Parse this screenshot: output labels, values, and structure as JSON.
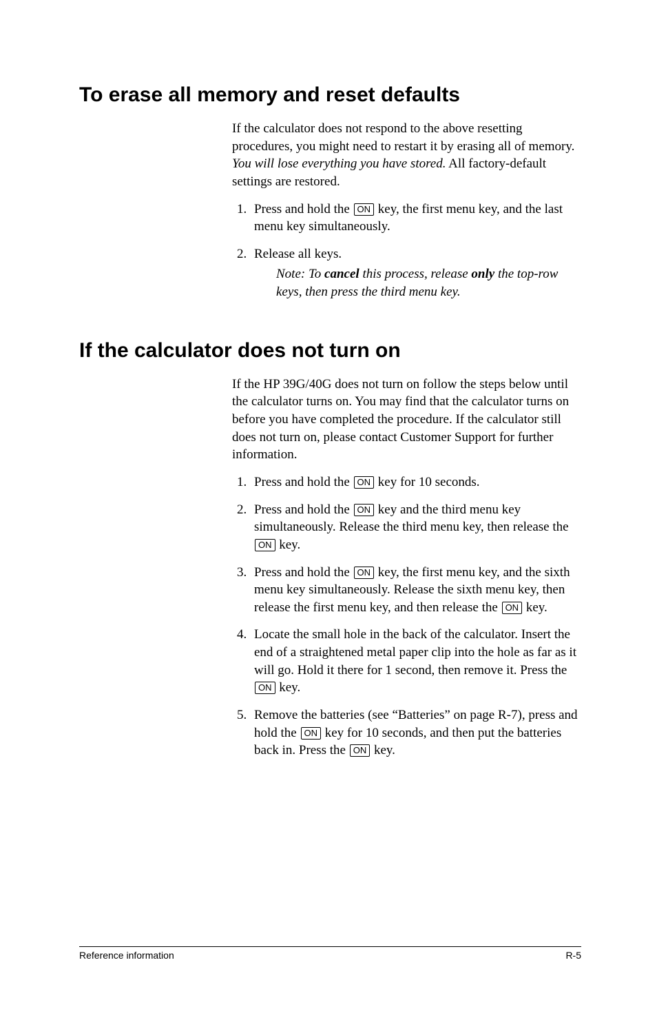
{
  "key_on": "ON",
  "section1": {
    "heading": "To erase all memory and reset defaults",
    "intro_a": "If the calculator does not respond to the above resetting procedures, you might need to restart it by erasing all of memory. ",
    "intro_italic": "You will lose everything you have stored.",
    "intro_b": " All factory-default settings are restored.",
    "step1_a": "Press and hold the ",
    "step1_b": " key, the first menu key, and the last menu key simultaneously.",
    "step2": "Release all keys.",
    "note_prefix": "Note: To ",
    "note_cancel": "cancel",
    "note_mid": " this process, release ",
    "note_only": "only",
    "note_tail": " the top-row keys, then press the third menu key."
  },
  "section2": {
    "heading": "If the calculator does not turn on",
    "intro": "If the HP 39G/40G does not turn on follow the steps below until the calculator turns on. You may find that the calculator turns on before you have completed the procedure. If the calculator still does not turn on, please contact Customer Support for further information.",
    "s1_a": "Press and hold the ",
    "s1_b": " key for 10 seconds.",
    "s2_a": "Press and hold the ",
    "s2_b": " key and the third menu key simultaneously. Release the third menu key, then release the ",
    "s2_c": " key.",
    "s3_a": "Press and hold the ",
    "s3_b": " key, the first menu key, and the sixth menu key simultaneously. Release the sixth menu key, then release the first menu key, and then release the ",
    "s3_c": " key.",
    "s4_a": "Locate the small hole in the back of the calculator. Insert the end of a straightened metal paper clip into the hole as far as it will go. Hold it there for 1 second, then remove it. Press the ",
    "s4_b": " key.",
    "s5_a": "Remove the batteries (see “Batteries” on page R-7), press and hold the ",
    "s5_b": " key for 10 seconds, and then put the batteries back in. Press the ",
    "s5_c": " key."
  },
  "footer": {
    "left": "Reference information",
    "right": "R-5"
  }
}
